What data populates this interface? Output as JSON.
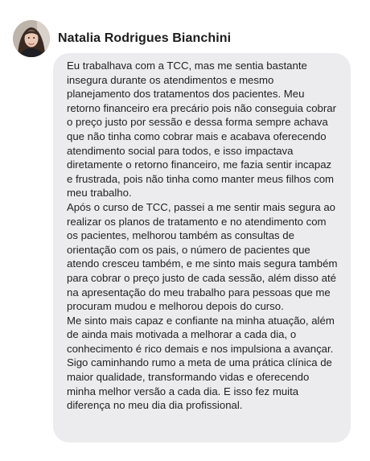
{
  "author": {
    "name": "Natalia Rodrigues Bianchini",
    "avatar_icon": "user-photo"
  },
  "testimonial": {
    "paragraphs": [
      "Eu trabalhava com a TCC, mas me sentia bastante insegura durante os atendimentos e mesmo planejamento dos tratamentos dos pacientes. Meu retorno financeiro era precário pois não conseguia cobrar o preço justo por sessão e dessa forma sempre achava que não tinha como cobrar mais e acabava oferecendo atendimento social para todos, e isso impactava diretamente o retorno financeiro, me fazia sentir incapaz e frustrada, pois não tinha como manter meus filhos com meu trabalho.",
      "Após o curso de TCC, passei a me sentir mais segura ao realizar os planos de tratamento e no atendimento com os pacientes, melhorou também as consultas de orientação com os pais, o número de pacientes que atendo cresceu também, e me sinto mais segura também para cobrar o preço justo de cada sessão, além disso até na apresentação do meu trabalho para pessoas que me procuram mudou e melhorou depois do curso.",
      "Me sinto mais capaz e confiante na minha atuação, além de ainda mais motivada a melhorar a cada dia, o conhecimento é rico demais e nos impulsiona a avançar. Sigo caminhando rumo a meta de uma prática clínica de maior qualidade, transformando vidas e oferecendo minha melhor versão a cada dia. E isso fez muita diferença no meu dia dia profissional."
    ]
  },
  "colors": {
    "bubble_background": "#ececee",
    "text": "#222222",
    "name": "#1c1c1c"
  }
}
